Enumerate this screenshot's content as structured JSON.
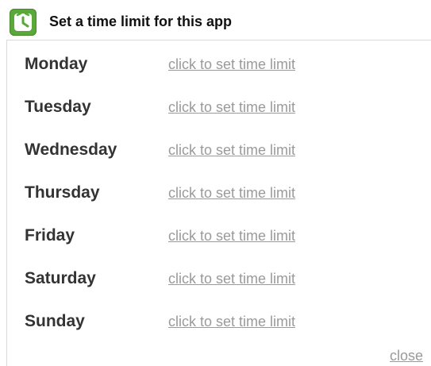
{
  "header": {
    "title": "Set a time limit for this app",
    "icon": "clock-app-icon",
    "icon_color": "#5aa73a"
  },
  "days": [
    {
      "day": "Monday",
      "action": "click to set time limit"
    },
    {
      "day": "Tuesday",
      "action": "click to set time limit"
    },
    {
      "day": "Wednesday",
      "action": "click to set time limit"
    },
    {
      "day": "Thursday",
      "action": "click to set time limit"
    },
    {
      "day": "Friday",
      "action": "click to set time limit"
    },
    {
      "day": "Saturday",
      "action": "click to set time limit"
    },
    {
      "day": "Sunday",
      "action": "click to set time limit"
    }
  ],
  "footer": {
    "close_label": "close"
  },
  "colors": {
    "link": "#9a9a9a",
    "day_text": "#333333"
  }
}
